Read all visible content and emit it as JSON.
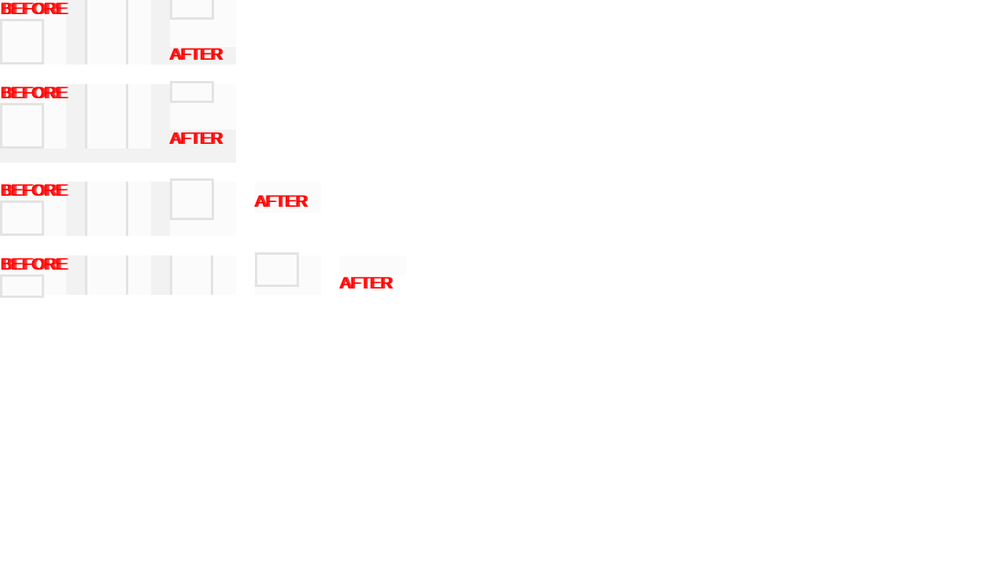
{
  "rows": [
    {
      "before_label": "BEFORE",
      "after_label": "AFTER"
    },
    {
      "before_label": "BEFORE",
      "after_label": "AFTER"
    },
    {
      "before_label": "BEFORE",
      "after_label": "AFTER"
    },
    {
      "before_label": "BEFORE",
      "after_label": "AFTER"
    }
  ],
  "colors": {
    "label": "#ff0000",
    "frame_border": "#e3e3e3",
    "panel_light": "#fbfbfb",
    "panel_grey": "#f2f2f2"
  }
}
